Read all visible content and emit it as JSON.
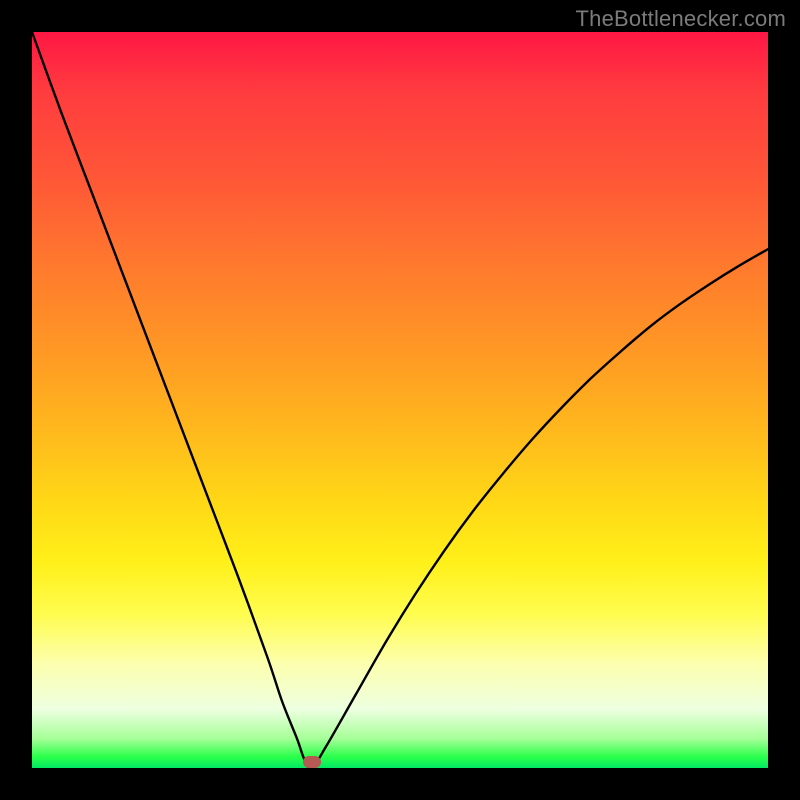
{
  "credit": "TheBottlenecker.com",
  "colors": {
    "page_bg": "#000000",
    "curve": "#000000",
    "marker": "#b55a52"
  },
  "chart_data": {
    "type": "line",
    "title": "",
    "xlabel": "",
    "ylabel": "",
    "xlim": [
      0,
      100
    ],
    "ylim": [
      0,
      100
    ],
    "x": [
      0,
      4,
      8,
      12,
      16,
      20,
      24,
      28,
      32,
      34,
      36,
      37,
      38,
      40,
      44,
      48,
      52,
      56,
      60,
      64,
      68,
      72,
      76,
      80,
      84,
      88,
      92,
      96,
      100
    ],
    "values": [
      100,
      89,
      78.5,
      68,
      57.5,
      47,
      36.5,
      26,
      15,
      9,
      4,
      1.2,
      0,
      3,
      10,
      17,
      23.5,
      29.5,
      35,
      40,
      44.7,
      49,
      53,
      56.6,
      60,
      63,
      65.7,
      68.2,
      70.5
    ],
    "marker": {
      "x": 38,
      "y": 0.8
    }
  }
}
